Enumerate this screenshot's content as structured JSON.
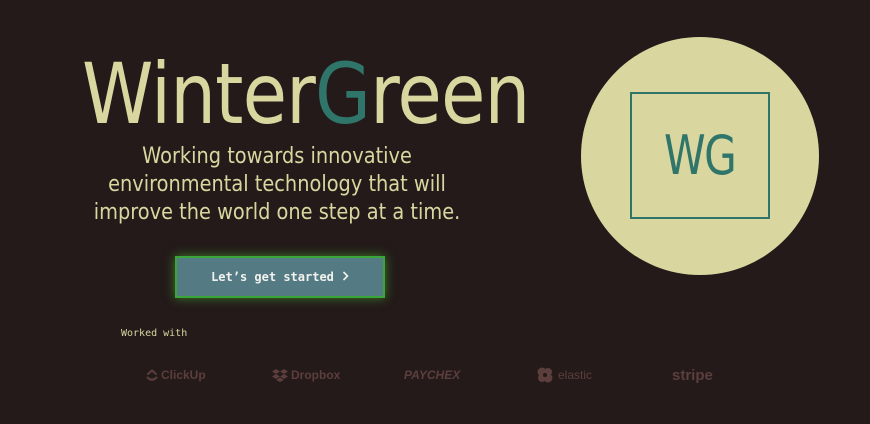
{
  "hero": {
    "brand_part1": "Winter",
    "brand_accent": "G",
    "brand_part2": "reen",
    "tagline_line1": "Working towards innovative",
    "tagline_line2": "environmental technology that will",
    "tagline_line3": "improve the world one step at a time.",
    "cta_label": "Let’s get started",
    "cta_icon": "chevron-right-icon"
  },
  "partners": {
    "heading": "Worked with",
    "logos": [
      {
        "name": "ClickUp",
        "icon": "clickup-icon"
      },
      {
        "name": "Dropbox",
        "icon": "dropbox-icon"
      },
      {
        "name": "PAYCHEX",
        "icon": ""
      },
      {
        "name": "elastic",
        "icon": "elastic-icon"
      },
      {
        "name": "stripe",
        "icon": ""
      }
    ]
  },
  "emblem": {
    "monogram": "WG"
  },
  "colors": {
    "background": "#231a19",
    "cream": "#d9d6a0",
    "teal": "#2f7569",
    "button": "#547a83",
    "button_glow": "#3aa63a",
    "logo_muted": "#5c3e3d"
  }
}
